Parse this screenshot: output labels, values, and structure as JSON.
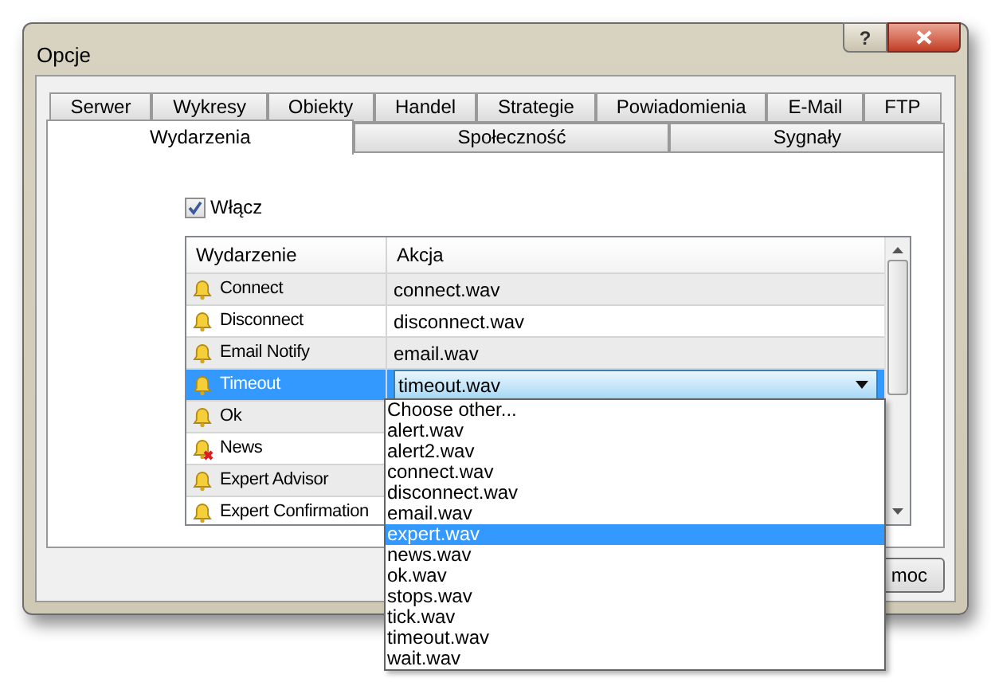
{
  "window": {
    "title": "Opcje",
    "help_button": "?"
  },
  "tabs": [
    [
      {
        "label": "Serwer",
        "selected": false
      },
      {
        "label": "Wykresy",
        "selected": false
      },
      {
        "label": "Obiekty",
        "selected": false
      },
      {
        "label": "Handel",
        "selected": false
      },
      {
        "label": "Strategie",
        "selected": false
      },
      {
        "label": "Powiadomienia",
        "selected": false
      },
      {
        "label": "E-Mail",
        "selected": false
      },
      {
        "label": "FTP",
        "selected": false
      }
    ],
    [
      {
        "label": "Wydarzenia",
        "selected": true
      },
      {
        "label": "Społeczność",
        "selected": false
      },
      {
        "label": "Sygnały",
        "selected": false
      }
    ]
  ],
  "enable": {
    "label": "Włącz",
    "checked": true
  },
  "table": {
    "columns": [
      "Wydarzenie",
      "Akcja"
    ],
    "rows": [
      {
        "event": "Connect",
        "action": "connect.wav",
        "muted": false,
        "selected": false
      },
      {
        "event": "Disconnect",
        "action": "disconnect.wav",
        "muted": false,
        "selected": false
      },
      {
        "event": "Email Notify",
        "action": "email.wav",
        "muted": false,
        "selected": false
      },
      {
        "event": "Timeout",
        "action": "timeout.wav",
        "muted": false,
        "selected": true
      },
      {
        "event": "Ok",
        "muted": false,
        "selected": false
      },
      {
        "event": "News",
        "muted": true,
        "selected": false
      },
      {
        "event": "Expert Advisor",
        "muted": false,
        "selected": false
      },
      {
        "event": "Expert Confirmation",
        "muted": false,
        "selected": false
      }
    ]
  },
  "dropdown": {
    "options": [
      {
        "label": "Choose other...",
        "selected": false
      },
      {
        "label": "alert.wav",
        "selected": false
      },
      {
        "label": "alert2.wav",
        "selected": false
      },
      {
        "label": "connect.wav",
        "selected": false
      },
      {
        "label": "disconnect.wav",
        "selected": false
      },
      {
        "label": "email.wav",
        "selected": false
      },
      {
        "label": "expert.wav",
        "selected": true
      },
      {
        "label": "news.wav",
        "selected": false
      },
      {
        "label": "ok.wav",
        "selected": false
      },
      {
        "label": "stops.wav",
        "selected": false
      },
      {
        "label": "tick.wav",
        "selected": false
      },
      {
        "label": "timeout.wav",
        "selected": false
      },
      {
        "label": "wait.wav",
        "selected": false
      }
    ]
  },
  "buttons": [
    "moc"
  ]
}
